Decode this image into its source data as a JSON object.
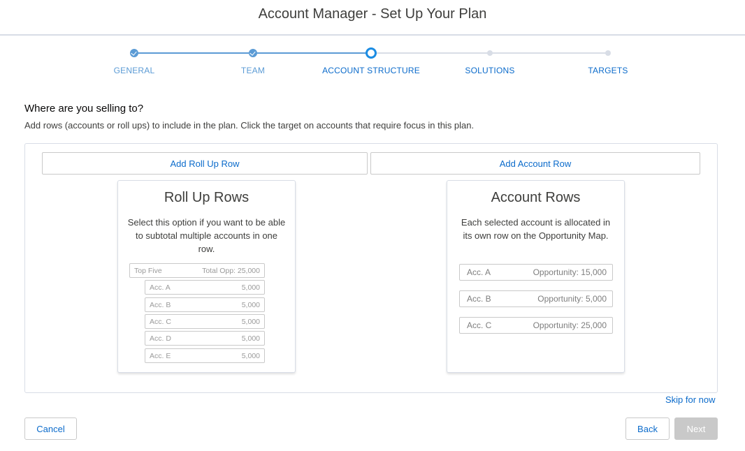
{
  "header": {
    "title": "Account Manager - Set Up Your Plan"
  },
  "steps": [
    {
      "label": "GENERAL",
      "state": "complete"
    },
    {
      "label": "TEAM",
      "state": "complete"
    },
    {
      "label": "ACCOUNT STRUCTURE",
      "state": "current"
    },
    {
      "label": "SOLUTIONS",
      "state": "upcoming"
    },
    {
      "label": "TARGETS",
      "state": "upcoming"
    }
  ],
  "content": {
    "question": "Where are you selling to?",
    "subtext": "Add rows (accounts or roll ups) to include in the plan. Click the target on accounts that require focus in this plan."
  },
  "panel": {
    "add_rollup_label": "Add Roll Up Row",
    "add_account_label": "Add Account Row",
    "rollup_card": {
      "title": "Roll Up Rows",
      "description": "Select this option if you want to be able to subtotal multiple accounts in one row.",
      "parent": {
        "name": "Top Five",
        "value": "Total Opp: 25,000"
      },
      "children": [
        {
          "name": "Acc. A",
          "value": "5,000"
        },
        {
          "name": "Acc. B",
          "value": "5,000"
        },
        {
          "name": "Acc. C",
          "value": "5,000"
        },
        {
          "name": "Acc. D",
          "value": "5,000"
        },
        {
          "name": "Acc. E",
          "value": "5,000"
        }
      ]
    },
    "account_card": {
      "title": "Account Rows",
      "description": "Each selected account is allocated in its own row on the Opportunity Map.",
      "rows": [
        {
          "name": "Acc. A",
          "value": "Opportunity: 15,000"
        },
        {
          "name": "Acc. B",
          "value": "Opportunity: 5,000"
        },
        {
          "name": "Acc. C",
          "value": "Opportunity: 25,000"
        }
      ]
    }
  },
  "footer": {
    "skip_label": "Skip for now",
    "cancel_label": "Cancel",
    "back_label": "Back",
    "next_label": "Next"
  },
  "colors": {
    "complete": "#5b9bd5",
    "current": "#1b8ce3",
    "upcoming": "#d8dde6",
    "link": "#0b6bcb",
    "disabled_button": "#c9c9c9"
  }
}
